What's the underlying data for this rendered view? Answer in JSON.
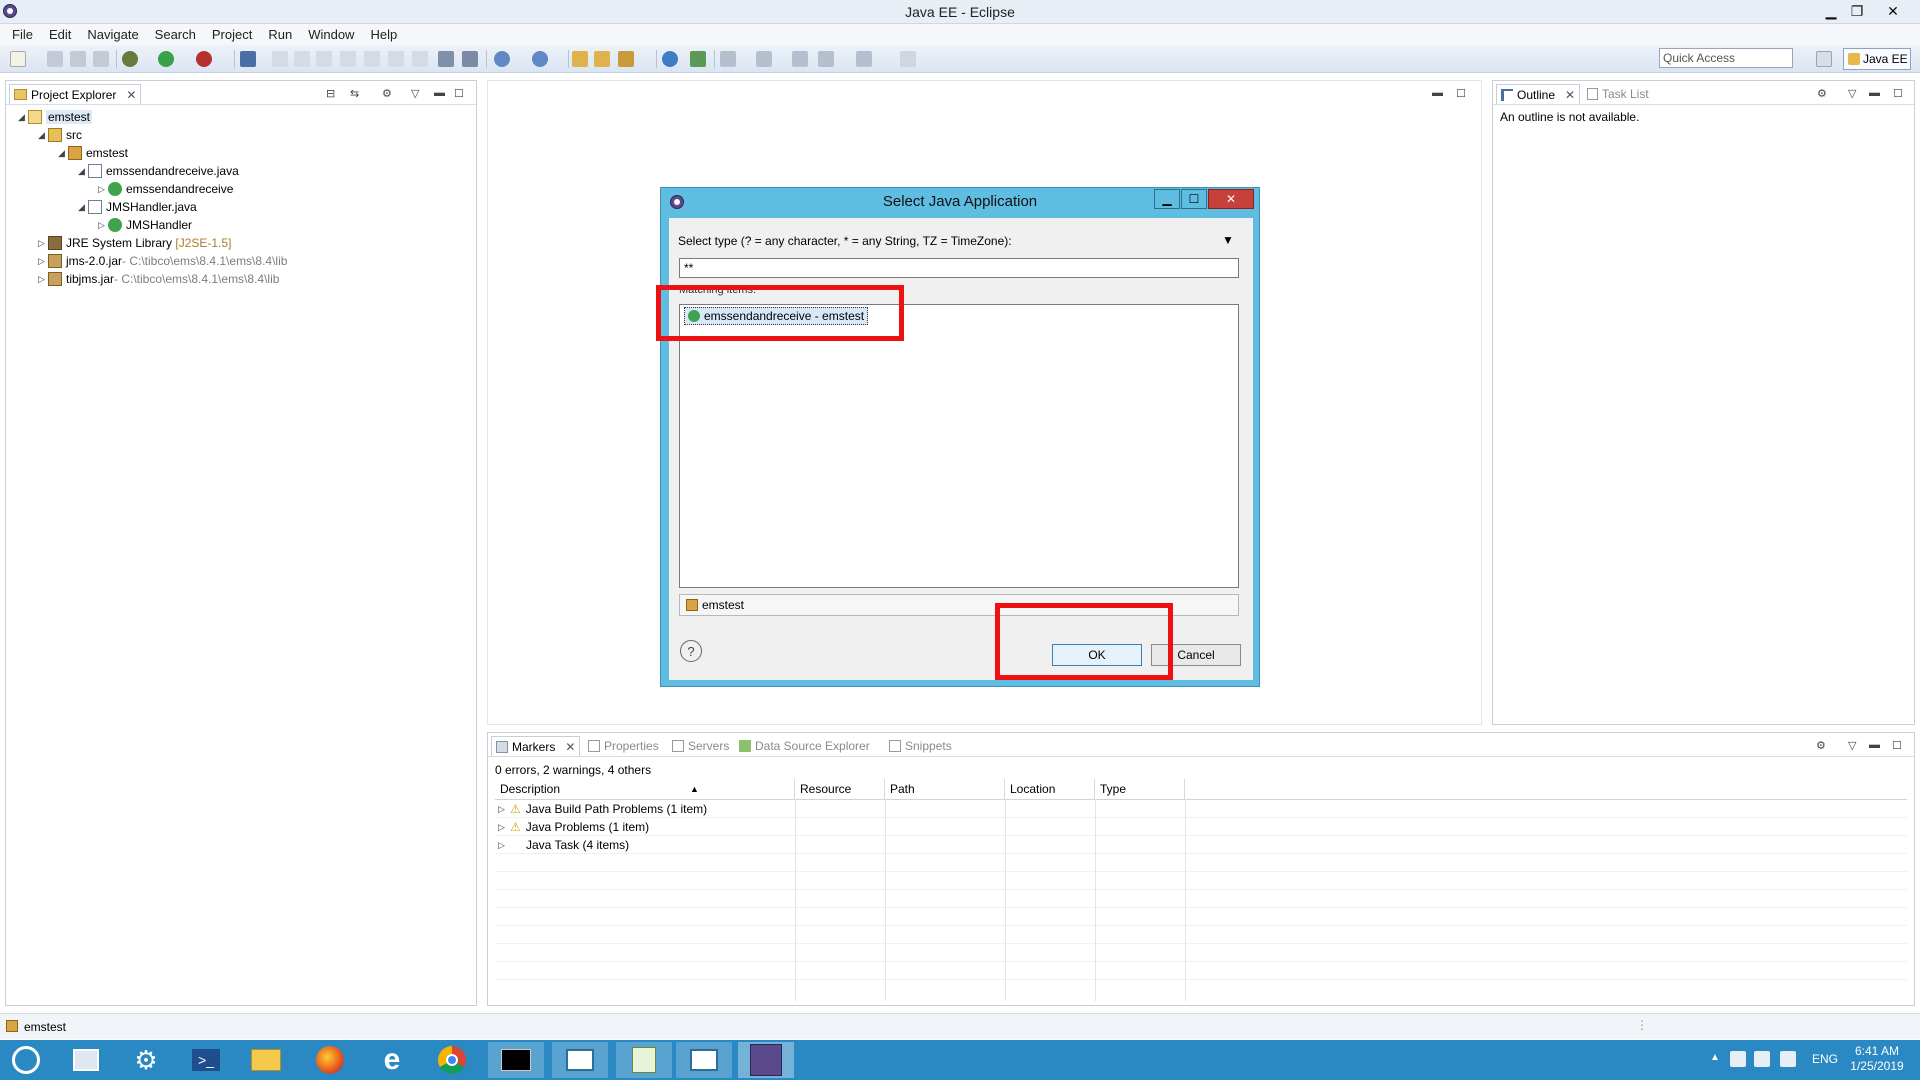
{
  "window": {
    "title": "Java EE - Eclipse"
  },
  "menu": [
    "File",
    "Edit",
    "Navigate",
    "Search",
    "Project",
    "Run",
    "Window",
    "Help"
  ],
  "toolbar": {
    "quick_access_placeholder": "Quick Access",
    "perspective_label": "Java EE"
  },
  "project_explorer": {
    "tab_label": "Project Explorer",
    "tree": [
      {
        "label": "emstest",
        "suffix": ""
      },
      {
        "label": "src",
        "suffix": ""
      },
      {
        "label": "emstest",
        "suffix": ""
      },
      {
        "label": "emssendandreceive.java",
        "suffix": ""
      },
      {
        "label": "emssendandreceive",
        "suffix": ""
      },
      {
        "label": "JMSHandler.java",
        "suffix": ""
      },
      {
        "label": "JMSHandler",
        "suffix": ""
      },
      {
        "label": "JRE System Library",
        "suffix": "[J2SE-1.5]"
      },
      {
        "label": "jms-2.0.jar",
        "suffix": " - C:\\tibco\\ems\\8.4.1\\ems\\8.4\\lib"
      },
      {
        "label": "tibjms.jar",
        "suffix": " - C:\\tibco\\ems\\8.4.1\\ems\\8.4\\lib"
      }
    ]
  },
  "outline": {
    "tab_label": "Outline",
    "task_list_label": "Task List",
    "message": "An outline is not available."
  },
  "bottom_panel": {
    "tabs": [
      "Markers",
      "Properties",
      "Servers",
      "Data Source Explorer",
      "Snippets"
    ],
    "summary": "0 errors, 2 warnings, 4 others",
    "columns": [
      "Description",
      "Resource",
      "Path",
      "Location",
      "Type"
    ],
    "rows": [
      "Java Build Path Problems (1 item)",
      "Java Problems (1 item)",
      "Java Task (4 items)"
    ]
  },
  "dialog": {
    "title": "Select Java Application",
    "type_label": "Select type (? = any character, * = any String, TZ = TimeZone):",
    "filter_value": "**",
    "matching_label": "Matching items:",
    "selected_item": "emssendandreceive - emstest",
    "package_value": "emstest",
    "ok_label": "OK",
    "cancel_label": "Cancel"
  },
  "status_bar": {
    "text": "emstest"
  },
  "taskbar": {
    "language": "ENG",
    "time": "6:41 AM",
    "date": "1/25/2019"
  },
  "colors": {
    "accent": "#2a89c3",
    "dialog_frame": "#5fbde2",
    "highlight": "#ee1111"
  }
}
